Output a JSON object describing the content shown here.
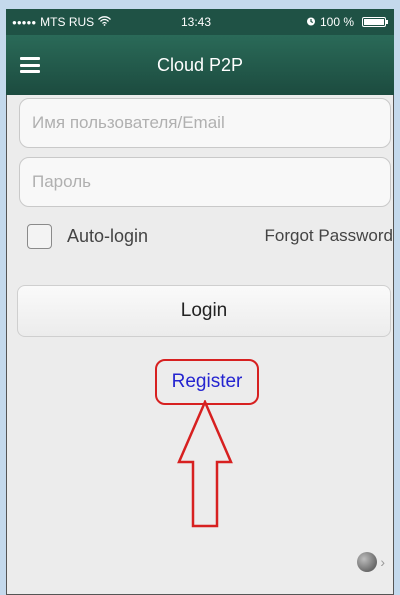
{
  "status_bar": {
    "signal": "●●●●●",
    "carrier": "MTS RUS",
    "wifi_icon": "wifi-icon",
    "time": "13:43",
    "alarm_icon": "alarm-icon",
    "battery_level": "100 %",
    "battery_fraction": 1.0
  },
  "navbar": {
    "title": "Cloud P2P",
    "menu_icon": "hamburger-menu-icon"
  },
  "login_form": {
    "username_placeholder": "Имя пользователя/Email",
    "username_value": "",
    "password_placeholder": "Пароль",
    "password_value": "",
    "auto_login_label": "Auto-login",
    "auto_login_checked": false,
    "forgot_password_label": "Forgot Password",
    "login_button_label": "Login",
    "register_link_label": "Register"
  },
  "footer": {
    "language_icon": "globe-icon",
    "chevron": "›"
  },
  "colors": {
    "navbar": "#1f5245",
    "register_text": "#2424d0",
    "annotation": "#d72020",
    "background": "#ececec"
  }
}
